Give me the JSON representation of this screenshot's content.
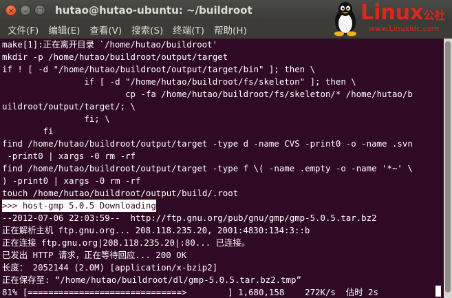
{
  "window": {
    "title": "hutao@hutao-ubuntu: ~/buildroot",
    "close_glyph": "×",
    "minimize_glyph": "–",
    "maximize_glyph": "□"
  },
  "menu": {
    "items": [
      {
        "label": "文件(F)"
      },
      {
        "label": "编辑(E)"
      },
      {
        "label": "查看(V)"
      },
      {
        "label": "搜索(S)"
      },
      {
        "label": "终端(T)"
      },
      {
        "label": "帮助(H)"
      }
    ]
  },
  "watermark": {
    "brand": "Linux",
    "brand_cn": "公社",
    "url": "www.Linuxidc.com",
    "color": "#e0261b"
  },
  "terminal": {
    "background": "#300a24",
    "foreground": "#ffffff",
    "lines": [
      "make[1]:正在离开目录 `/home/hutao/buildroot'",
      "mkdir -p /home/hutao/buildroot/output/target",
      "if ! [ -d \"/home/hutao/buildroot/output/target/bin\" ]; then \\",
      "                if [ -d \"/home/hutao/buildroot/fs/skeleton\" ]; then \\",
      "                        cp -fa /home/hutao/buildroot/fs/skeleton/* /home/hutao/b",
      "uildroot/output/target/; \\",
      "                fi; \\",
      "        fi",
      "find /home/hutao/buildroot/output/target -type d -name CVS -print0 -o -name .svn",
      " -print0 | xargs -0 rm -rf",
      "find /home/hutao/buildroot/output/target -type f \\( -name .empty -o -name '*~' \\",
      ") -print0 | xargs -0 rm -rf",
      "touch /home/hutao/buildroot/output/build/.root",
      ">>> host-gmp 5.0.5 Downloading",
      "--2012-07-06 22:03:59--  http://ftp.gnu.org/pub/gnu/gmp/gmp-5.0.5.tar.bz2",
      "正在解析主机 ftp.gnu.org... 208.118.235.20, 2001:4830:134:3::b",
      "正在连接 ftp.gnu.org|208.118.235.20|:80... 已连接。",
      "已发出 HTTP 请求，正在等待回应... 200 OK",
      "长度： 2052144 (2.0M) [application/x-bzip2]",
      "正在保存至: “/home/hutao/buildroot/dl/gmp-5.0.5.tar.bz2.tmp”",
      "",
      "81% [==============================>        ] 1,680,158    272K/s  估时 2s"
    ]
  }
}
